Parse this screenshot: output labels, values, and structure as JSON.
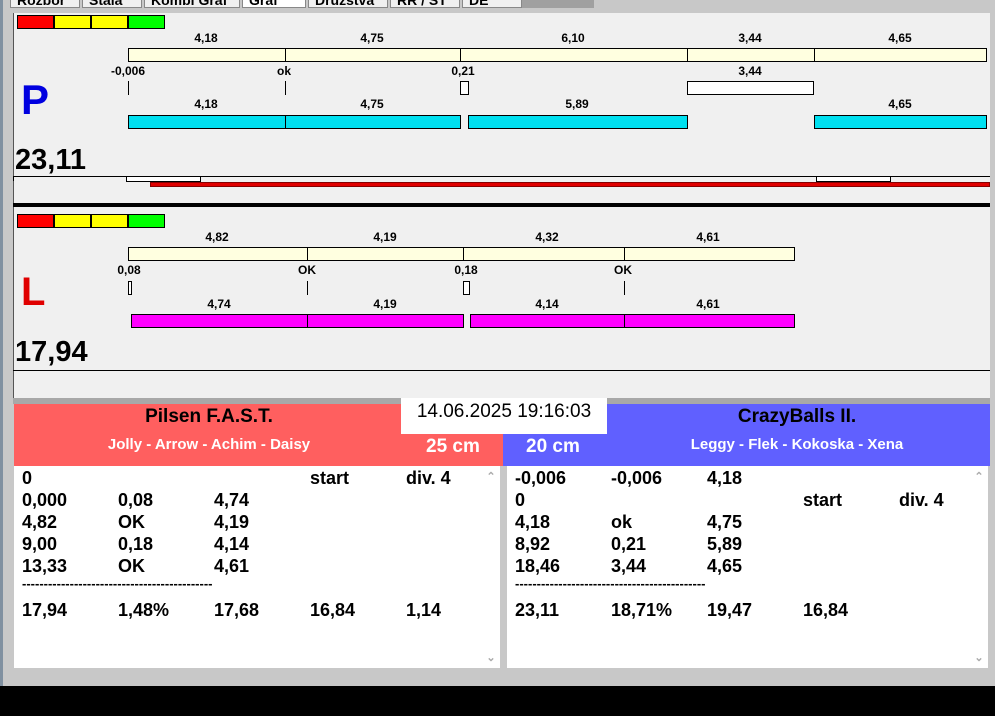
{
  "tabs": [
    "Rozbor",
    "Stála",
    "Kombi Graf",
    "Graf",
    "Družstva",
    "RR / ST",
    "DE"
  ],
  "colors": {
    "legend": [
      "#ff0000",
      "#ffff00",
      "#ffff00",
      "#00ff00"
    ],
    "p_bar": "#00e0f0",
    "l_bar": "#ff00ff",
    "team_left": "#ff5f5f",
    "team_right": "#6060ff"
  },
  "p_panel": {
    "letter": "P",
    "total": "23,11",
    "row1": [
      "4,18",
      "4,75",
      "6,10",
      "3,44",
      "4,65"
    ],
    "row2": [
      "-0,006",
      "ok",
      "0,21",
      "3,44"
    ],
    "row3": [
      "4,18",
      "4,75",
      "5,89",
      "4,65"
    ]
  },
  "l_panel": {
    "letter": "L",
    "total": "17,94",
    "row1": [
      "4,82",
      "4,19",
      "4,32",
      "4,61"
    ],
    "row2": [
      "0,08",
      "OK",
      "0,18",
      "OK"
    ],
    "row3": [
      "4,74",
      "4,19",
      "4,14",
      "4,61"
    ]
  },
  "datetime": "14.06.2025 19:16:03",
  "left_team": {
    "name": "Pilsen F.A.S.T.",
    "players": "Jolly - Arrow - Achim - Daisy",
    "distance": "25 cm",
    "rows": [
      [
        "0",
        "",
        "",
        "start",
        "div. 4"
      ],
      [
        "0,000",
        "0,08",
        "4,74",
        "",
        ""
      ],
      [
        "4,82",
        "OK",
        "4,19",
        "",
        ""
      ],
      [
        "9,00",
        "0,18",
        "4,14",
        "",
        ""
      ],
      [
        "13,33",
        "OK",
        "4,61",
        "",
        ""
      ]
    ],
    "separator": "--------------------------------------------",
    "summary": [
      "17,94",
      "1,48%",
      "17,68",
      "16,84",
      "1,14"
    ]
  },
  "right_team": {
    "name": "CrazyBalls II.",
    "players": "Leggy - Flek - Kokoska - Xena",
    "distance": "20 cm",
    "rows": [
      [
        "-0,006",
        "-0,006",
        "4,18",
        "",
        ""
      ],
      [
        "0",
        "",
        "",
        "start",
        "div. 4"
      ],
      [
        "4,18",
        "ok",
        "4,75",
        "",
        ""
      ],
      [
        "8,92",
        "0,21",
        "5,89",
        "",
        ""
      ],
      [
        "18,46",
        "3,44",
        "4,65",
        "",
        ""
      ]
    ],
    "separator": "--------------------------------------------",
    "summary": [
      "23,11",
      "18,71%",
      "19,47",
      "16,84",
      ""
    ]
  }
}
